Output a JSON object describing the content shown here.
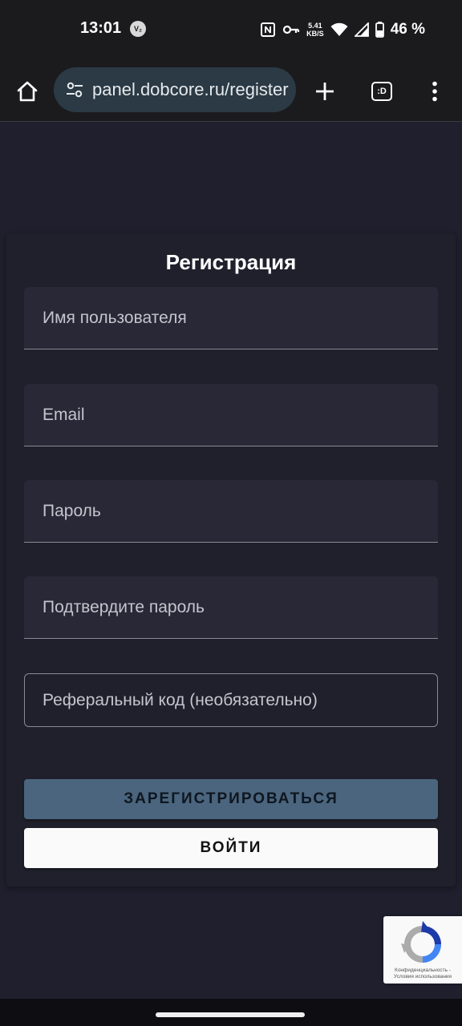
{
  "status_bar": {
    "time": "13:01",
    "vz_badge": "V₂",
    "net_speed_value": "5.41",
    "net_speed_unit": "KB/S",
    "battery_percent": "46 %"
  },
  "browser": {
    "url": "panel.dobcore.ru/register",
    "tabs_label": ":D"
  },
  "form": {
    "title": "Регистрация",
    "username_placeholder": "Имя пользователя",
    "email_placeholder": "Email",
    "password_placeholder": "Пароль",
    "confirm_password_placeholder": "Подтвердите пароль",
    "referral_placeholder": "Реферальный код (необязательно)",
    "register_label": "ЗАРЕГИСТРИРОВАТЬСЯ",
    "login_label": "ВОЙТИ"
  },
  "recaptcha": {
    "privacy": "Конфиденциальность",
    "separator": " - ",
    "terms": "Условия использования"
  },
  "colors": {
    "page_background": "#1f1f2d",
    "card_background": "#20202c",
    "field_background": "#282836",
    "register_button": "#4a657d",
    "login_button": "#fafafa",
    "url_pill": "#2b3a44"
  },
  "icons": [
    "home-icon",
    "site-settings-icon",
    "plus-icon",
    "tab-switcher-icon",
    "more-vert-icon",
    "nfc-icon",
    "vpn-key-icon",
    "wifi-icon",
    "signal-icon",
    "battery-icon",
    "recaptcha-icon"
  ]
}
